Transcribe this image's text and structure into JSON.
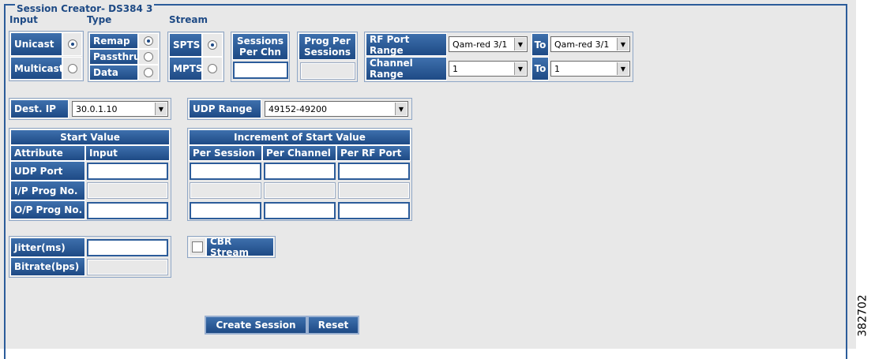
{
  "title": "Session Creator- DS384 3",
  "headers": {
    "input": "Input",
    "type": "Type",
    "stream": "Stream"
  },
  "input_options": [
    {
      "label": "Unicast",
      "selected": true
    },
    {
      "label": "Multicast",
      "selected": false
    }
  ],
  "type_options": [
    {
      "label": "Remap",
      "selected": true
    },
    {
      "label": "Passthru",
      "selected": false
    },
    {
      "label": "Data",
      "selected": false
    }
  ],
  "stream_options": [
    {
      "label": "SPTS",
      "selected": true
    },
    {
      "label": "MPTS",
      "selected": false
    }
  ],
  "sessions_per_chn": {
    "label_line1": "Sessions",
    "label_line2": "Per Chn",
    "value": ""
  },
  "prog_per_sessions": {
    "label_line1": "Prog Per",
    "label_line2": "Sessions",
    "value": ""
  },
  "rf_port_range": {
    "label": "RF Port Range",
    "from": "Qam-red 3/1",
    "to_label": "To",
    "to": "Qam-red 3/1"
  },
  "channel_range": {
    "label": "Channel Range",
    "from": "1",
    "to_label": "To",
    "to": "1"
  },
  "dest_ip": {
    "label": "Dest. IP",
    "value": "30.0.1.10"
  },
  "udp_range": {
    "label": "UDP Range",
    "value": "49152-49200"
  },
  "start_value": {
    "title": "Start Value",
    "col_attribute": "Attribute",
    "col_input": "Input",
    "rows": [
      {
        "label": "UDP Port",
        "value": ""
      },
      {
        "label": "I/P Prog No.",
        "value": ""
      },
      {
        "label": "O/P Prog No.",
        "value": ""
      }
    ]
  },
  "increment": {
    "title": "Increment of Start Value",
    "cols": [
      "Per Session",
      "Per Channel",
      "Per RF Port"
    ]
  },
  "jitter": {
    "label": "Jitter(ms)",
    "value": ""
  },
  "bitrate": {
    "label": "Bitrate(bps)",
    "value": ""
  },
  "cbr_stream": {
    "label": "CBR Stream",
    "checked": false
  },
  "buttons": {
    "create": "Create Session",
    "reset": "Reset"
  },
  "figure_id": "382702",
  "colors": {
    "header_blue": "#1e4a85",
    "panel_bg": "#e8e8e8",
    "title_text": "#1e4a85"
  }
}
